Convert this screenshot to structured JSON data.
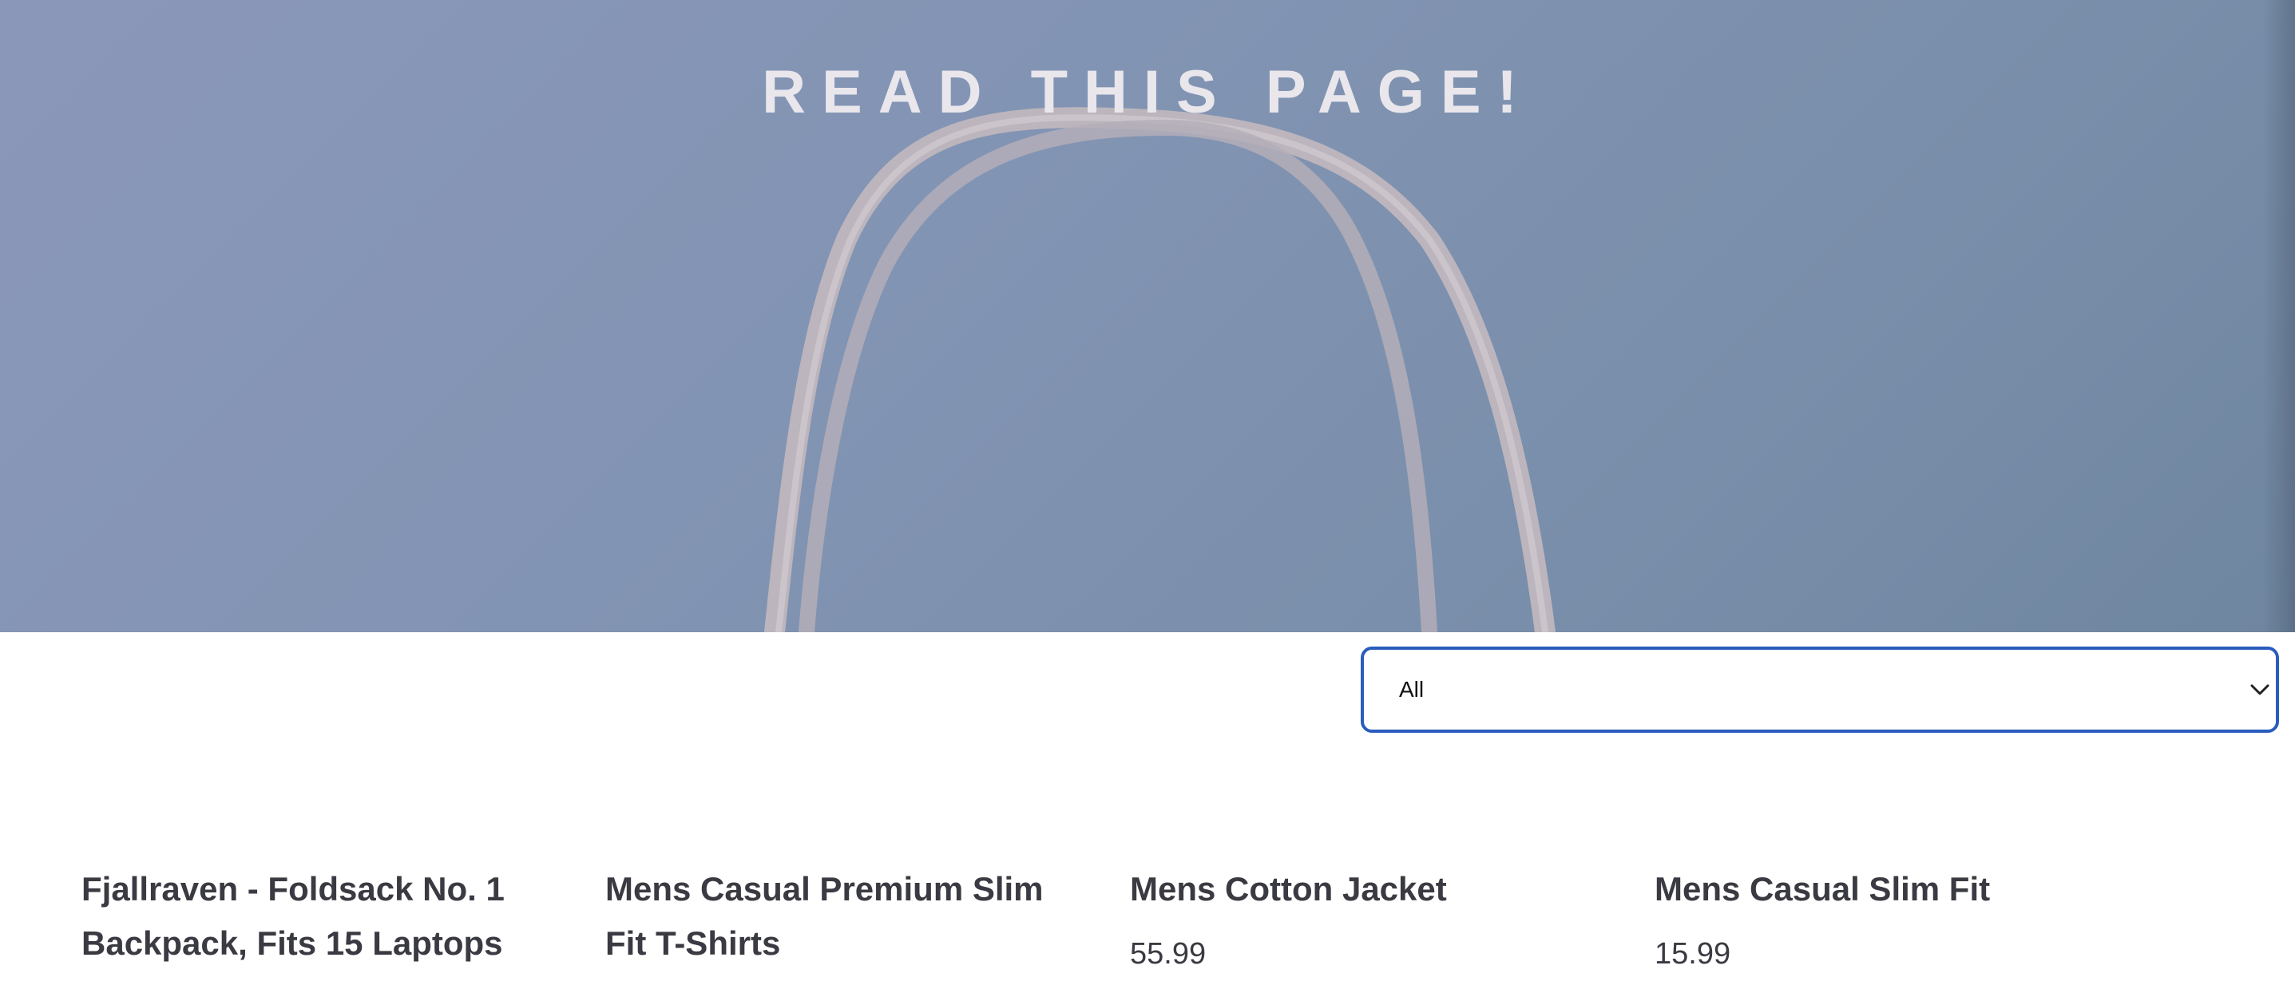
{
  "hero": {
    "title": "READ THIS PAGE!"
  },
  "filter": {
    "selected": "All",
    "icon": "chevron-down-icon"
  },
  "products": [
    {
      "title": "Fjallraven - Foldsack No. 1 Backpack, Fits 15 Laptops",
      "price": ""
    },
    {
      "title": "Mens Casual Premium Slim Fit T-Shirts",
      "price": ""
    },
    {
      "title": "Mens Cotton Jacket",
      "price": "55.99"
    },
    {
      "title": "Mens Casual Slim Fit",
      "price": "15.99"
    }
  ],
  "colors": {
    "hero_bg": "#8294b3",
    "title_text": "#e9e6ec",
    "select_border": "#2a5cbd",
    "product_text": "#3a3a42"
  }
}
